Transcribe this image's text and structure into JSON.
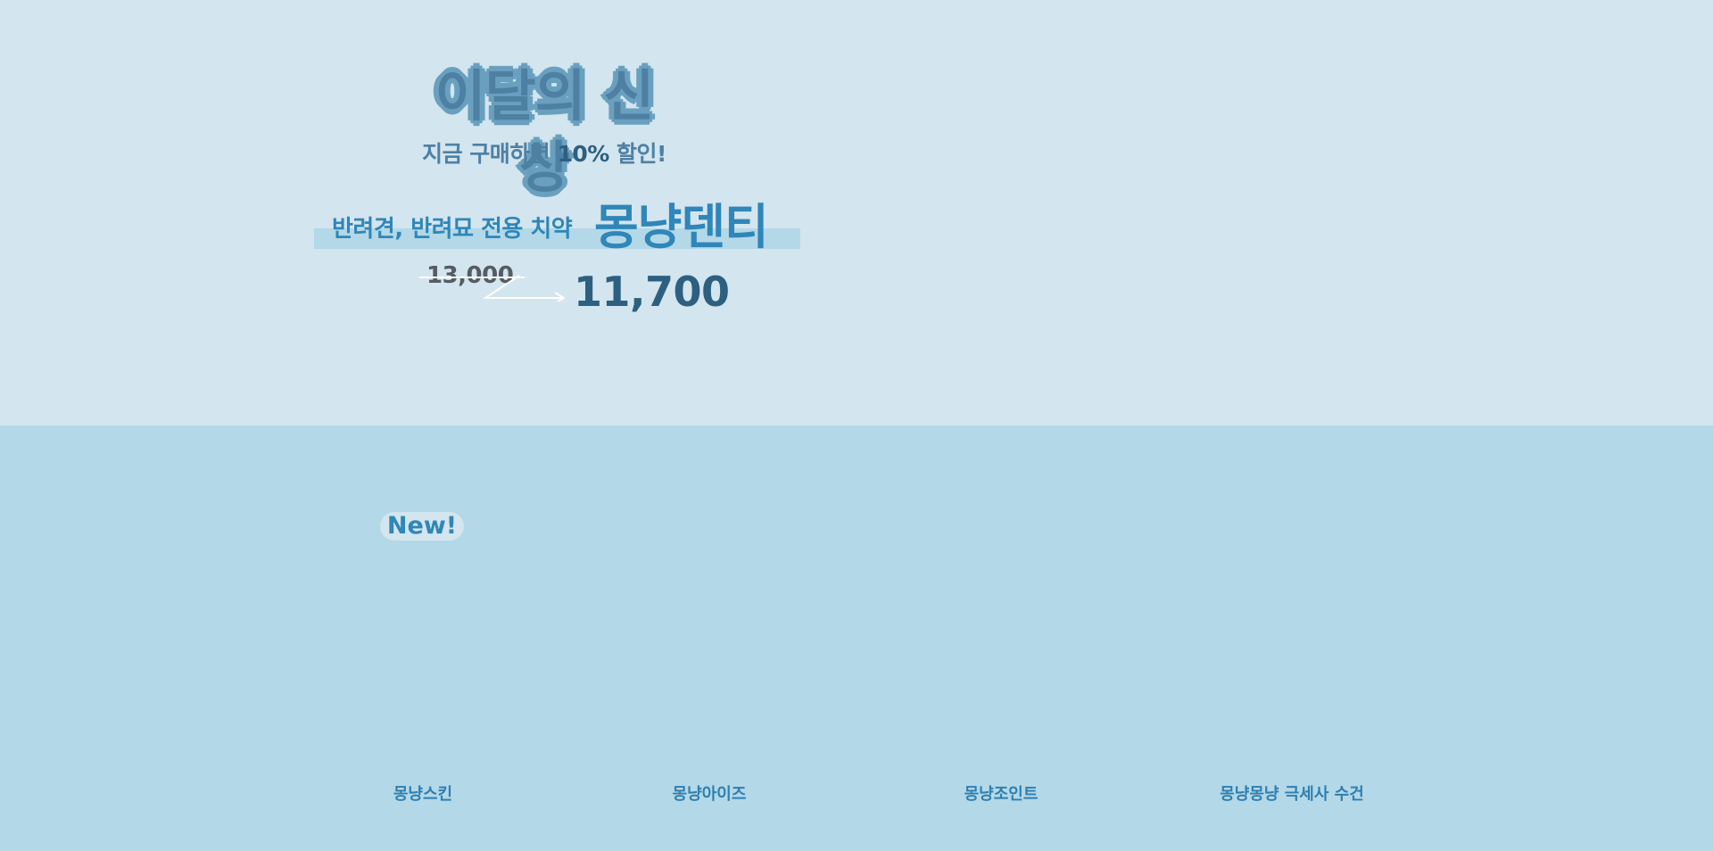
{
  "hero": {
    "title": "이달의 신상",
    "subtitle_prefix": "지금 구매하면 ",
    "subtitle_percent": "10%",
    "subtitle_suffix": " 할인!",
    "product_description": "반려견, 반려묘 전용 치약",
    "product_name": "몽냥덴티",
    "old_price": "13,000",
    "new_price": "11,700"
  },
  "new_section": {
    "badge_label": "New!"
  },
  "products": [
    {
      "name": "몽냥스킨"
    },
    {
      "name": "몽냥아이즈"
    },
    {
      "name": "몽냥조인트"
    },
    {
      "name": "몽냥몽냥 극세사 수건"
    }
  ],
  "colors": {
    "hero_background": "#d3e5ef",
    "section_background": "#b3d8e8",
    "accent_blue": "#2f86b8",
    "dark_blue": "#2d5f80",
    "muted_blue": "#4e80a3",
    "old_price_gray": "#555c62"
  }
}
